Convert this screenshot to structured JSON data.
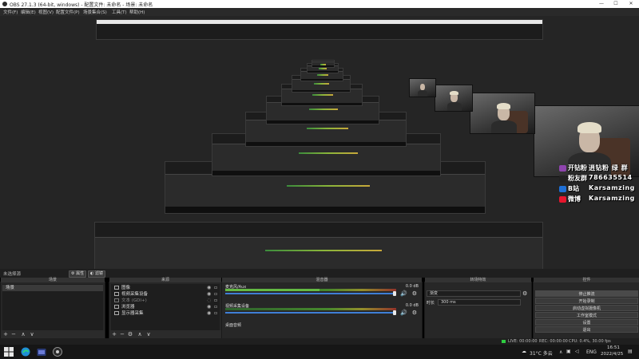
{
  "window": {
    "title": "OBS 27.1.3 (64-bit, windows) - 配置文件: 未命名 - 场景: 未命名",
    "controls": {
      "minimize": "—",
      "maximize": "☐",
      "close": "✕"
    }
  },
  "menu": [
    "文件(F)",
    "编辑(E)",
    "视图(V)",
    "配置文件(P)",
    "场景集合(S)",
    "工具(T)",
    "帮助(H)"
  ],
  "social_overlay": [
    {
      "icon": "kuaishou-icon",
      "color": "#8e44ad",
      "label": "开钻粉",
      "value": "逍钻粉 绿 群"
    },
    {
      "icon": "weibo-fans-icon",
      "color": "#222222",
      "label": "粉友群",
      "value": "786635514"
    },
    {
      "icon": "bilibili-icon",
      "color": "#1e6fd6",
      "label": "B站",
      "value": "Karsamzing"
    },
    {
      "icon": "weibo-icon",
      "color": "#e6162d",
      "label": "微博",
      "value": "Karsamzing"
    }
  ],
  "scene_bar": {
    "label": "未选择源",
    "properties_label": "属性",
    "filters_label": "滤镜"
  },
  "docks": {
    "scenes": {
      "title": "场景",
      "items": [
        "场景"
      ]
    },
    "sources": {
      "title": "来源",
      "items": [
        {
          "icon": "image-icon",
          "name": "图像"
        },
        {
          "icon": "video-capture-icon",
          "name": "视频采集设备"
        },
        {
          "icon": "text-icon",
          "name": "文本 (GDI+)"
        },
        {
          "icon": "window-icon",
          "name": "浏览器"
        },
        {
          "icon": "display-capture-icon",
          "name": "显示器采集"
        }
      ]
    },
    "mixer": {
      "title": "混音器",
      "channels": [
        {
          "name": "麦克风/Aux",
          "db": "0.0 dB",
          "level": 0.55
        },
        {
          "name": "视频采集设备",
          "db": "0.0 dB",
          "level": 0.0
        },
        {
          "name": "桌面音频",
          "db": "",
          "level": 0.0
        }
      ]
    },
    "transitions": {
      "title": "转场特效",
      "type": "渐变",
      "duration_label": "时长",
      "duration_value": "300 ms"
    },
    "controls": {
      "title": "控件",
      "buttons": [
        "停止推流",
        "开始录制",
        "启动虚拟摄像机",
        "工作室模式",
        "设置",
        "退出"
      ]
    }
  },
  "status": {
    "dropped": "",
    "live": "LIVE: 00:00:00",
    "rec": "REC: 00:00:00",
    "cpu": "CPU: 0.4%, 30.00 fps"
  },
  "taskbar": {
    "weather": "31°C 多云",
    "lang": "ENG",
    "time": "16:51",
    "date": "2022/4/25"
  }
}
